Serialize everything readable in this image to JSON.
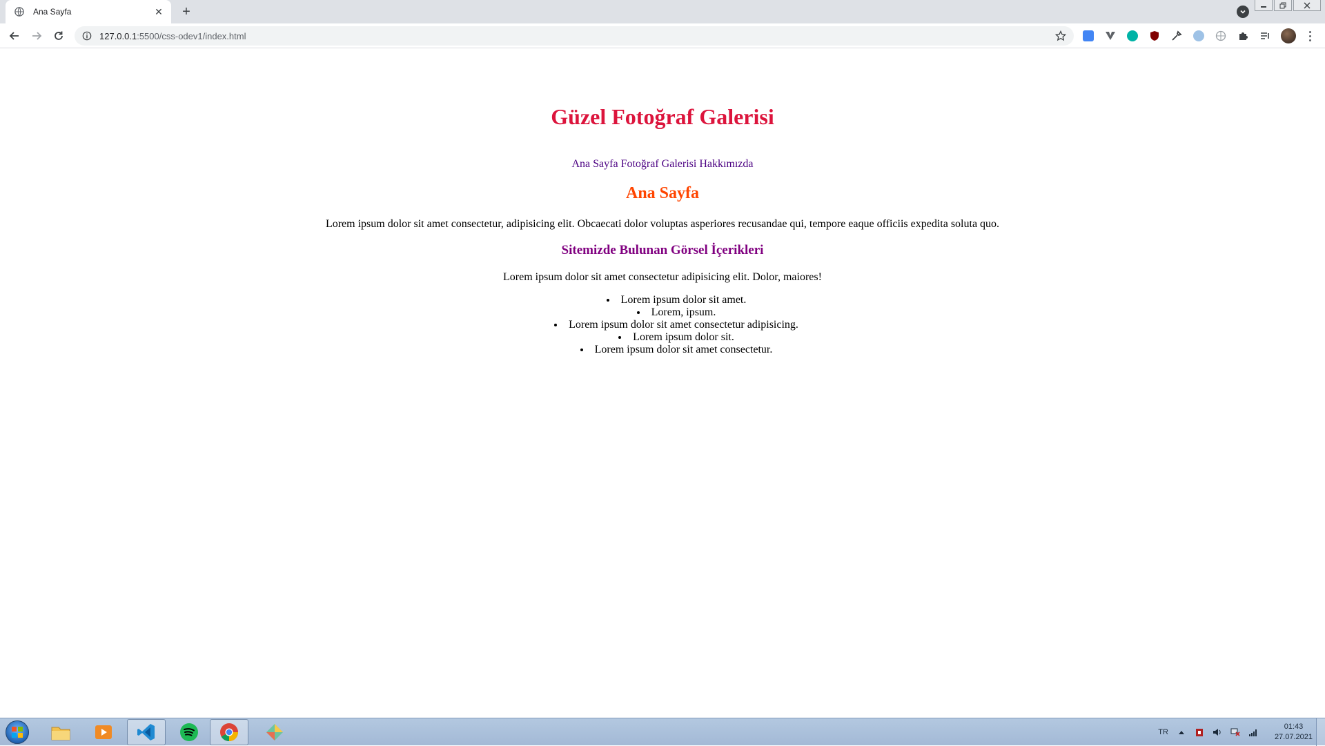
{
  "browser": {
    "tab": {
      "title": "Ana Sayfa"
    },
    "address": {
      "host": "127.0.0.1",
      "path": ":5500/css-odev1/index.html"
    },
    "extension_icons": [
      "google-translate-icon",
      "vuetify-icon",
      "m-extension-icon",
      "ublock-icon",
      "eyedropper-icon",
      "speed-dial-icon",
      "globe-icon",
      "puzzle-icon",
      "media-queue-icon"
    ]
  },
  "page": {
    "heading": "Güzel Fotoğraf Galerisi",
    "nav_links": [
      "Ana Sayfa",
      "Fotoğraf Galerisi",
      "Hakkımızda"
    ],
    "section_title": "Ana Sayfa",
    "intro_paragraph": "Lorem ipsum dolor sit amet consectetur, adipisicing elit. Obcaecati dolor voluptas asperiores recusandae qui, tempore eaque officiis expedita soluta quo.",
    "subsection_title": "Sitemizde Bulunan Görsel İçerikleri",
    "second_paragraph": "Lorem ipsum dolor sit amet consectetur adipisicing elit. Dolor, maiores!",
    "list_items": [
      "Lorem ipsum dolor sit amet.",
      "Lorem, ipsum.",
      "Lorem ipsum dolor sit amet consectetur adipisicing.",
      "Lorem ipsum dolor sit.",
      "Lorem ipsum dolor sit amet consectetur."
    ],
    "colors": {
      "heading": "#dc143c",
      "nav": "#4b0082",
      "section_title": "#ff4500",
      "subsection_title": "#800080"
    }
  },
  "taskbar": {
    "apps": [
      "file-explorer-icon",
      "media-player-icon",
      "vscode-icon",
      "spotify-icon",
      "chrome-icon",
      "gitkraken-icon"
    ],
    "active_app": "chrome-icon",
    "language": "TR",
    "time": "01:43",
    "date": "27.07.2021"
  }
}
